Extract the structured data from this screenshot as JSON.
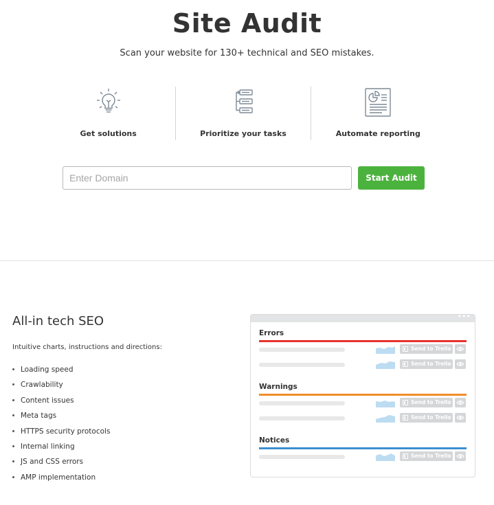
{
  "header": {
    "title": "Site Audit",
    "subtitle": "Scan your website for 130+ technical and SEO mistakes."
  },
  "features": [
    {
      "label": "Get solutions",
      "icon": "lightbulb-icon"
    },
    {
      "label": "Prioritize your tasks",
      "icon": "task-list-icon"
    },
    {
      "label": "Automate reporting",
      "icon": "report-document-icon"
    }
  ],
  "search": {
    "placeholder": "Enter Domain",
    "value": "",
    "button_label": "Start Audit"
  },
  "section": {
    "title": "All-in tech SEO",
    "description": "Intuitive charts, instructions and directions:",
    "items": [
      "Loading speed",
      "Crawlability",
      "Content issues",
      "Meta tags",
      "HTTPS security protocols",
      "Internal linking",
      "JS and CSS errors",
      "AMP implementation"
    ]
  },
  "panel": {
    "menu_dots": "•••",
    "trello_label": "Send to Trello",
    "groups": [
      {
        "title": "Errors",
        "color": "#e8302e",
        "rows": 2
      },
      {
        "title": "Warnings",
        "color": "#f28d2a",
        "rows": 2
      },
      {
        "title": "Notices",
        "color": "#3c8fd0",
        "rows": 1
      }
    ]
  },
  "colors": {
    "accent_green": "#4cb23e",
    "sparkline_blue": "#bcdcf2"
  }
}
